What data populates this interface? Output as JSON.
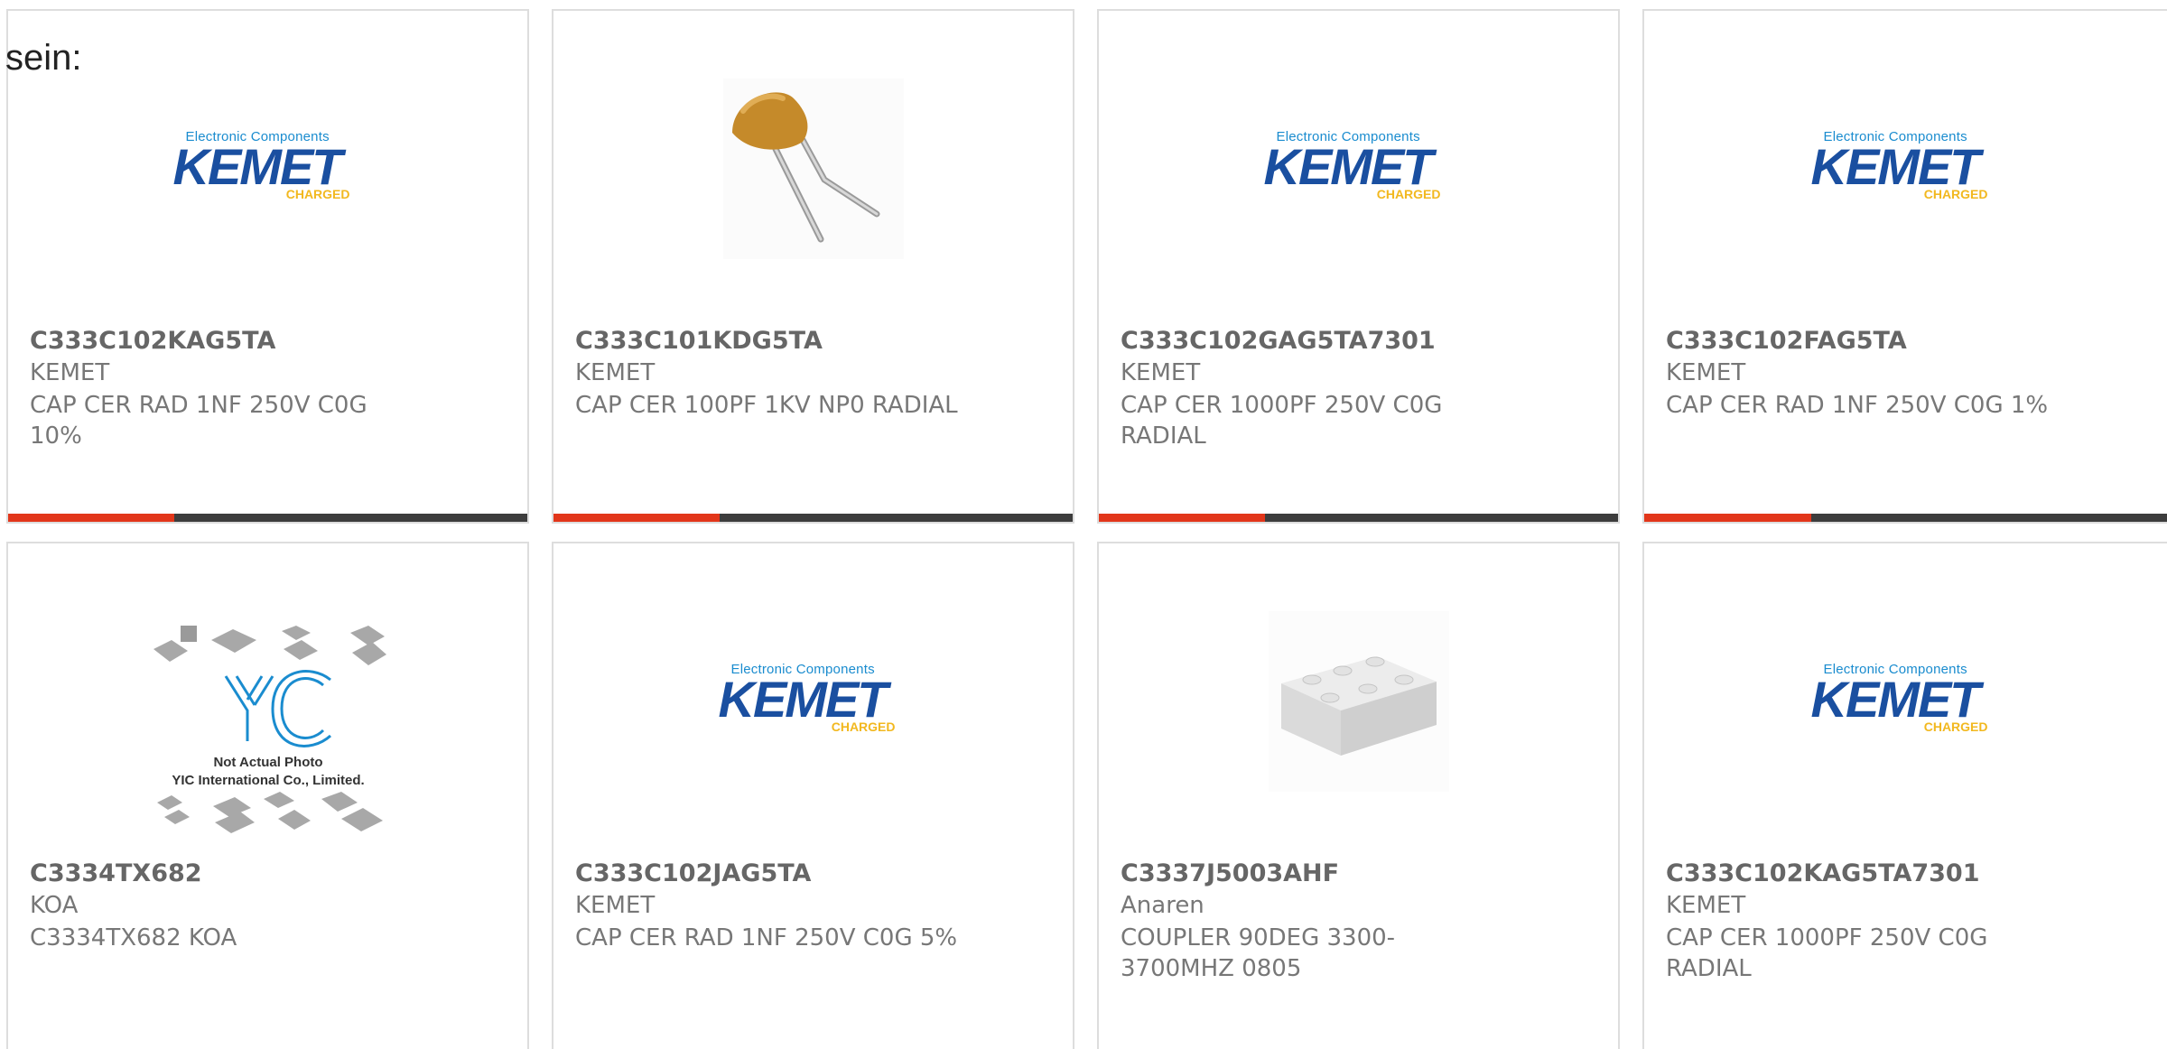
{
  "intro": {
    "text": "sein:"
  },
  "logos": {
    "kemet": {
      "tagline": "Electronic Components",
      "word": "KEMET",
      "charged": "CHARGED"
    },
    "yic": {
      "caption_1": "Not Actual Photo",
      "caption_2": "YIC International Co., Limited."
    }
  },
  "colors": {
    "progress_fill": "#e2361a",
    "progress_track": "#3d3d3d",
    "border": "#dddddd",
    "kemet_blue": "#1a4fa0",
    "kemet_yellow": "#f2b81f"
  },
  "products": [
    {
      "part": "C333C102KAG5TA",
      "manufacturer": "KEMET",
      "description": "CAP CER RAD 1NF 250V C0G 10%",
      "image": "kemet-logo",
      "progress": 0.32
    },
    {
      "part": "C333C101KDG5TA",
      "manufacturer": "KEMET",
      "description": "CAP CER 100PF 1KV NP0 RADIAL",
      "image": "radial-capacitor-photo",
      "progress": 0.32
    },
    {
      "part": "C333C102GAG5TA7301",
      "manufacturer": "KEMET",
      "description": "CAP CER 1000PF 250V C0G RADIAL",
      "image": "kemet-logo",
      "progress": 0.32
    },
    {
      "part": "C333C102FAG5TA",
      "manufacturer": "KEMET",
      "description": "CAP CER RAD 1NF 250V C0G 1%",
      "image": "kemet-logo",
      "progress": 0.32
    },
    {
      "part": "C3334TX682",
      "manufacturer": "KOA",
      "description": "C3334TX682 KOA",
      "image": "yic-placeholder"
    },
    {
      "part": "C333C102JAG5TA",
      "manufacturer": "KEMET",
      "description": "CAP CER RAD 1NF 250V C0G 5%",
      "image": "kemet-logo"
    },
    {
      "part": "C3337J5003AHF",
      "manufacturer": "Anaren",
      "description": "COUPLER 90DEG 3300-3700MHZ 0805",
      "image": "smd-package-photo"
    },
    {
      "part": "C333C102KAG5TA7301",
      "manufacturer": "KEMET",
      "description": "CAP CER 1000PF 250V C0G RADIAL",
      "image": "kemet-logo"
    }
  ]
}
